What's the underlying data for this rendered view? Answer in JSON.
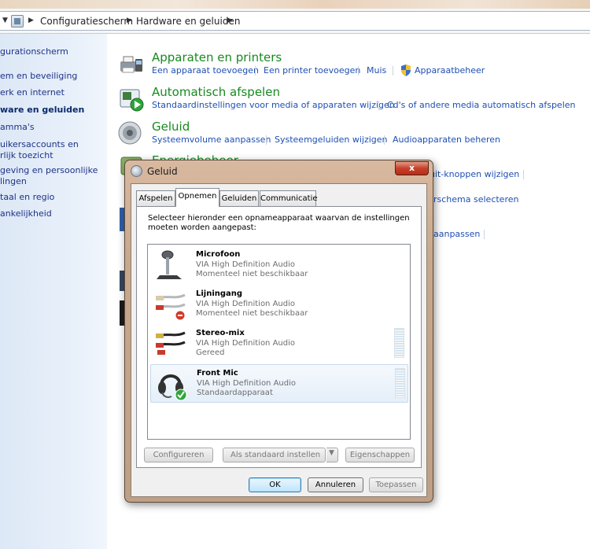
{
  "address_bar": {
    "breadcrumbs": [
      "Configuratiescherm",
      "Hardware en geluiden"
    ]
  },
  "left_pane": {
    "items": [
      "gurationscherm",
      "em en beveiliging",
      "erk en internet",
      "ware en geluiden",
      "amma's",
      "uikersaccounts en",
      "rlijk toezicht",
      "geving en persoonlijke",
      "lingen",
      "taal en regio",
      "ankelijkheid"
    ]
  },
  "categories": {
    "devices": {
      "title": "Apparaten en printers",
      "links": [
        "Een apparaat toevoegen",
        "Een printer toevoegen",
        "Muis",
        "Apparaatbeheer"
      ]
    },
    "autoplay": {
      "title": "Automatisch afspelen",
      "links": [
        "Standaardinstellingen voor media of apparaten wijzigen",
        "Cd's of andere media automatisch afspelen"
      ]
    },
    "sound": {
      "title": "Geluid",
      "links": [
        "Systeemvolume aanpassen",
        "Systeemgeluiden wijzigen",
        "Audioapparaten beheren"
      ]
    },
    "power": {
      "title": "Energiebeheer",
      "partial_links": [
        "uit-knoppen wijzigen",
        "rschema selecteren",
        "aanpassen"
      ]
    }
  },
  "dialog": {
    "title": "Geluid",
    "close_glyph": "x",
    "tabs": [
      "Afspelen",
      "Opnemen",
      "Geluiden",
      "Communicatie"
    ],
    "active_tab": "Opnemen",
    "instruction": "Selecteer hieronder een opnameapparaat waarvan de instellingen moeten worden aangepast:",
    "devices": [
      {
        "name": "Microfoon",
        "driver": "VIA High Definition Audio",
        "status": "Momenteel niet beschikbaar",
        "icon": "microphone-icon"
      },
      {
        "name": "Lijningang",
        "driver": "VIA High Definition Audio",
        "status": "Momenteel niet beschikbaar",
        "icon": "line-in-cable-icon"
      },
      {
        "name": "Stereo-mix",
        "driver": "VIA High Definition Audio",
        "status": "Gereed",
        "icon": "stereo-mix-cable-icon"
      },
      {
        "name": "Front Mic",
        "driver": "VIA High Definition Audio",
        "status": "Standaardapparaat",
        "icon": "headset-icon"
      }
    ],
    "buttons": {
      "configure": "Configureren",
      "set_default": "Als standaard instellen",
      "properties": "Eigenschappen",
      "ok": "OK",
      "cancel": "Annuleren",
      "apply": "Toepassen"
    },
    "colors": {
      "titlebar": "#c8a88c",
      "close": "#c7402a",
      "default_check": "#2fa53a",
      "disabled_badge": "#d23a2a"
    }
  },
  "colors": {
    "category_title": "#178a1f",
    "link": "#1e4fb3",
    "nav_text": "#1e3287"
  }
}
